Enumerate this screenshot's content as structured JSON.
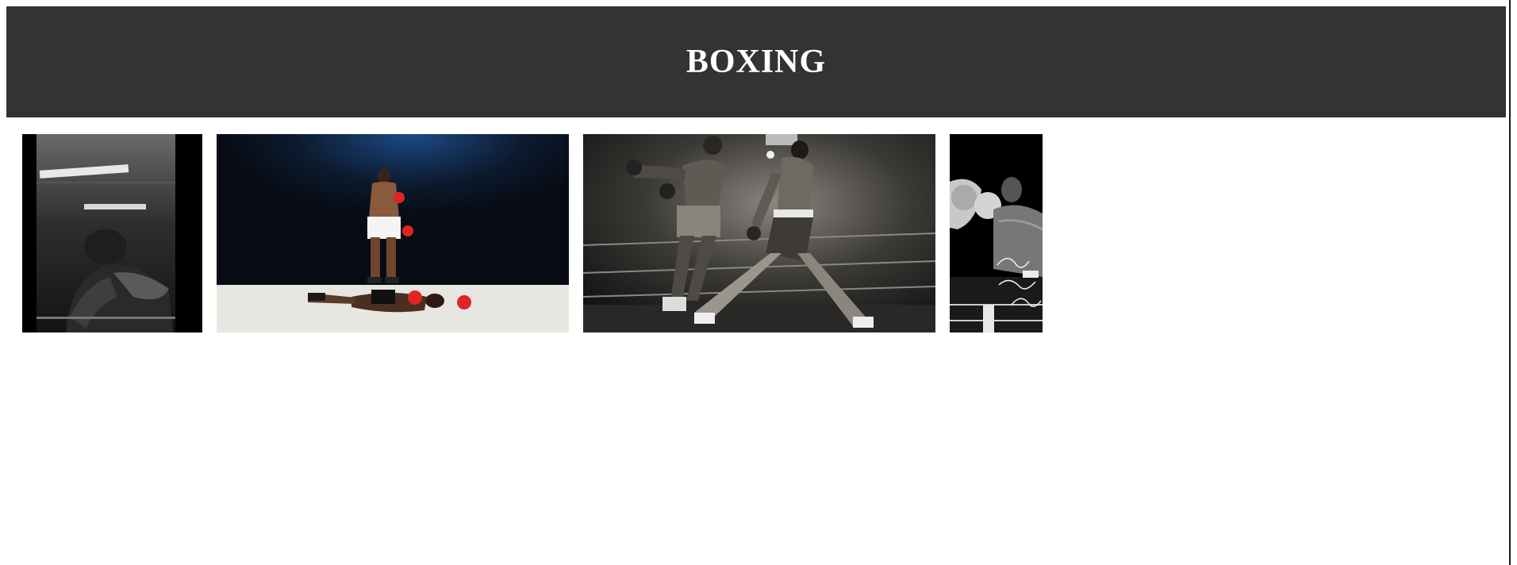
{
  "page": {
    "title": "BOXING"
  },
  "colors": {
    "header_bg": "#333333",
    "header_text": "#ffffff",
    "page_bg": "#ffffff"
  },
  "gallery": {
    "photos": [
      {
        "name": "boxer-training-photo",
        "icon": "photo-icon"
      },
      {
        "name": "ali-over-liston-photo",
        "icon": "photo-icon"
      },
      {
        "name": "ali-frazier-fight-photo",
        "icon": "photo-icon"
      },
      {
        "name": "tyson-signed-photo",
        "icon": "photo-icon"
      }
    ]
  }
}
